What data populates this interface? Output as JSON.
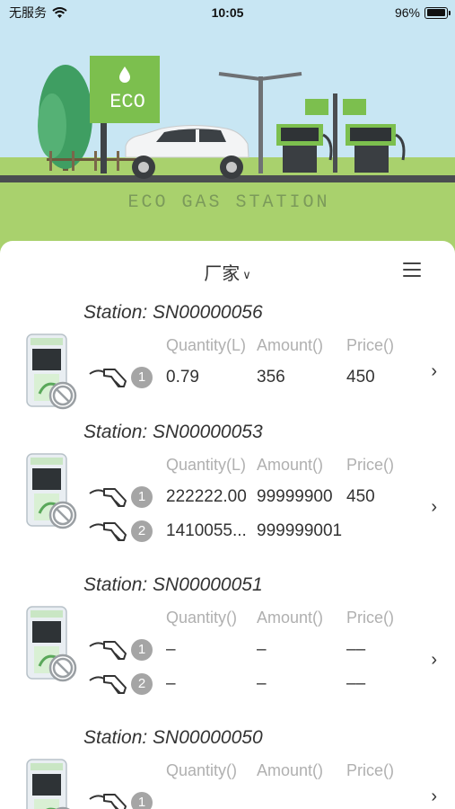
{
  "status_bar": {
    "carrier": "无服务",
    "time": "10:05",
    "battery_percent": "96%",
    "battery_level": 0.96
  },
  "banner": {
    "sign_text": "ECO",
    "station_caption": "ECO GAS STATION"
  },
  "toolbar": {
    "manufacturer_label": "厂家",
    "menu_icon": "menu-icon"
  },
  "stations": [
    {
      "title": "Station: SN00000056",
      "col_quantity": "Quantity(L)",
      "col_amount": "Amount()",
      "col_price": "Price()",
      "nozzles": [
        {
          "num": "1",
          "quantity": "0.79",
          "amount": "356",
          "price": "450"
        }
      ]
    },
    {
      "title": "Station: SN00000053",
      "col_quantity": "Quantity(L)",
      "col_amount": "Amount()",
      "col_price": "Price()",
      "nozzles": [
        {
          "num": "1",
          "quantity": "222222.00",
          "amount": "99999900",
          "price": "450"
        },
        {
          "num": "2",
          "quantity": "1410055...",
          "amount": "999999001",
          "price": ""
        }
      ]
    },
    {
      "title": "Station: SN00000051",
      "col_quantity": "Quantity()",
      "col_amount": "Amount()",
      "col_price": "Price()",
      "nozzles": [
        {
          "num": "1",
          "quantity": "–",
          "amount": "–",
          "price": "––"
        },
        {
          "num": "2",
          "quantity": "–",
          "amount": "–",
          "price": "––"
        }
      ]
    },
    {
      "title": "Station: SN00000050",
      "col_quantity": "Quantity()",
      "col_amount": "Amount()",
      "col_price": "Price()",
      "nozzles": [
        {
          "num": "1",
          "quantity": "",
          "amount": "",
          "price": ""
        }
      ]
    }
  ]
}
